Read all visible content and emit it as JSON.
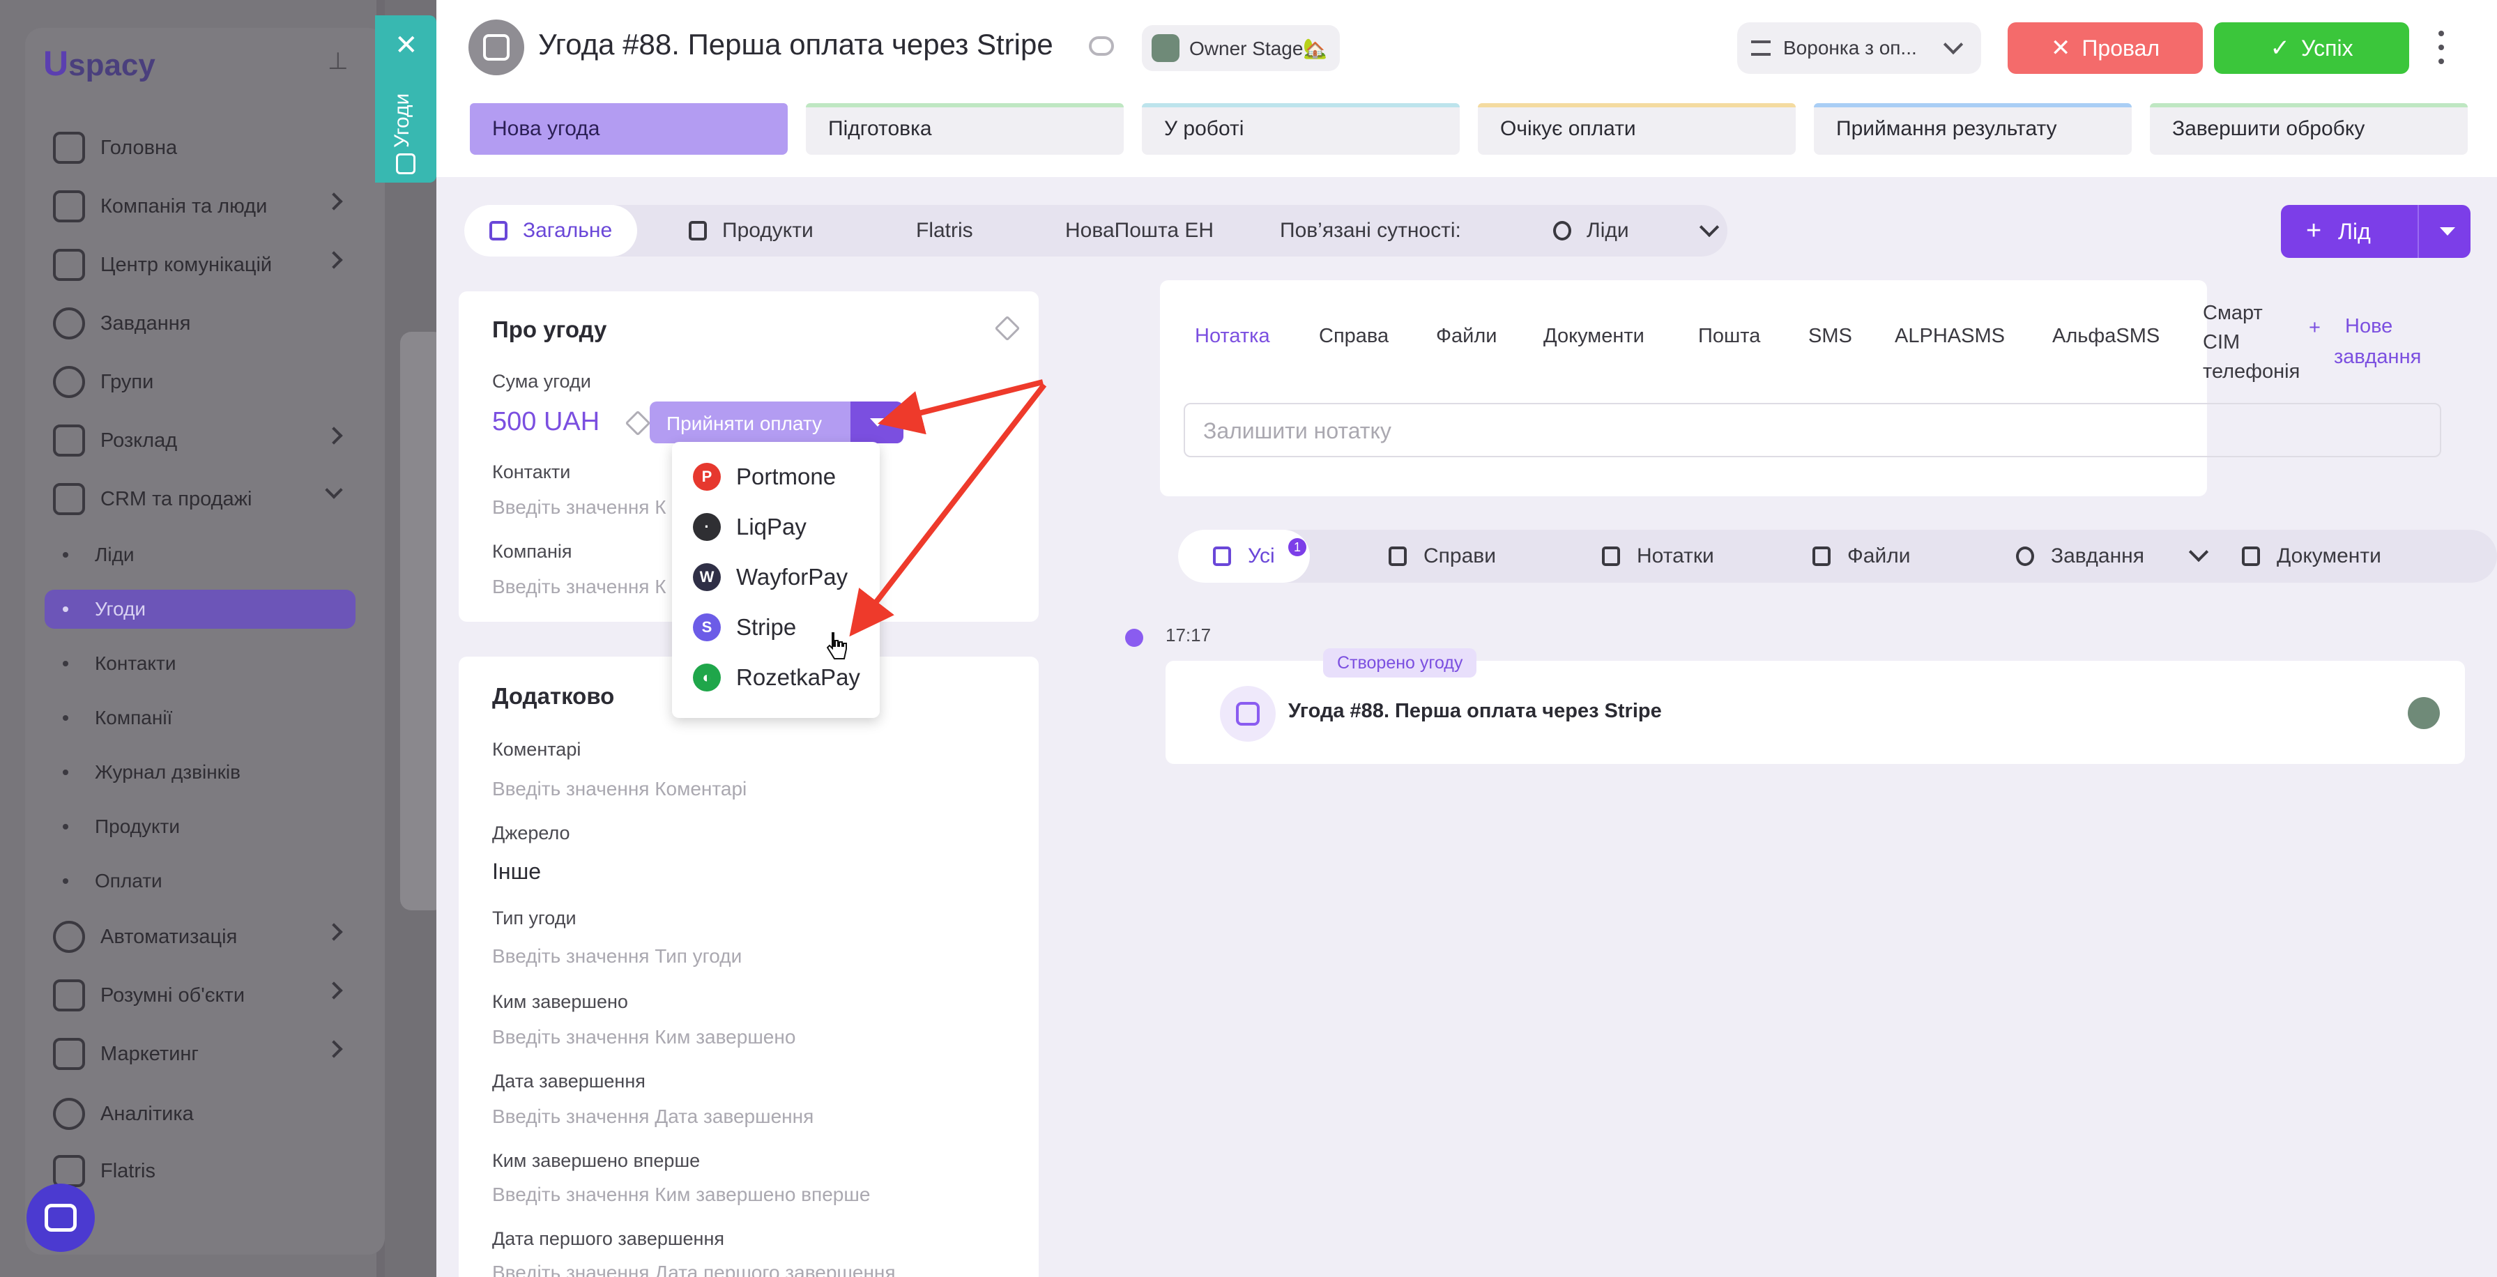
{
  "sidebar": {
    "logo": "spacy",
    "logo_u": "U",
    "items": [
      {
        "label": "Головна"
      },
      {
        "label": "Компанія та люди"
      },
      {
        "label": "Центр комунікацій"
      },
      {
        "label": "Завдання"
      },
      {
        "label": "Групи"
      },
      {
        "label": "Розклад"
      },
      {
        "label": "CRM та продажі"
      }
    ],
    "crm_sub": [
      {
        "label": "Ліди"
      },
      {
        "label": "Угоди"
      },
      {
        "label": "Контакти"
      },
      {
        "label": "Компанії"
      },
      {
        "label": "Журнал дзвінків"
      },
      {
        "label": "Продукти"
      },
      {
        "label": "Оплати"
      }
    ],
    "bottom_items": [
      {
        "label": "Автоматизація"
      },
      {
        "label": "Розумні об'єкти"
      },
      {
        "label": "Маркетинг"
      },
      {
        "label": "Аналітика"
      },
      {
        "label": "Flatris"
      }
    ]
  },
  "side_tab": {
    "label": "Угоди"
  },
  "header": {
    "title": "Угода #88. Перша оплата через Stripe",
    "owner_stage": "Owner Stage🏡",
    "funnel": "Воронка з оп...",
    "fail_label": "Провал",
    "success_label": "Успіх"
  },
  "stages": [
    {
      "label": "Нова угода"
    },
    {
      "label": "Підготовка"
    },
    {
      "label": "У роботі"
    },
    {
      "label": "Очікує оплати"
    },
    {
      "label": "Приймання результату"
    },
    {
      "label": "Завершити обробку"
    }
  ],
  "colors": {
    "stage_bars": [
      "#b39cf2",
      "#bfe7c2",
      "#bde4ec",
      "#f4dba0",
      "#a9cef5",
      "#bfe7c2"
    ],
    "accent": "#7c3ee8",
    "fail": "#f46b6b",
    "success": "#3bc63b"
  },
  "tabs": {
    "general": "Загальне",
    "products": "Продукти",
    "flatris": "Flatris",
    "novaposhta": "НоваПошта ЕН",
    "related": "Пов’язані сутності:",
    "leads": "Ліди"
  },
  "lid_button": "Лід",
  "about": {
    "title": "Про угоду",
    "amount_label": "Сума угоди",
    "amount": "500 UAH",
    "pay_button": "Прийняти оплату",
    "contacts_label": "Контакти",
    "contacts_ph": "Введіть значення К",
    "company_label": "Компанія",
    "company_ph": "Введіть значення К"
  },
  "payment_options": [
    {
      "label": "Portmone",
      "color": "#e6382e",
      "glyph": "P"
    },
    {
      "label": "LiqPay",
      "color": "#2f2f33",
      "glyph": "·"
    },
    {
      "label": "WayforPay",
      "color": "#2f2f46",
      "glyph": "W"
    },
    {
      "label": "Stripe",
      "color": "#6c5ce7",
      "glyph": "S"
    },
    {
      "label": "RozetkaPay",
      "color": "#1fa64a",
      "glyph": "◐"
    }
  ],
  "extra": {
    "title": "Додатково",
    "fields": [
      {
        "label": "Коментарі",
        "value": "Введіть значення Коментарі",
        "placeholder": true
      },
      {
        "label": "Джерело",
        "value": "Інше",
        "placeholder": false
      },
      {
        "label": "Тип угоди",
        "value": "Введіть значення Тип угоди",
        "placeholder": true
      },
      {
        "label": "Ким завершено",
        "value": "Введіть значення Ким завершено",
        "placeholder": true
      },
      {
        "label": "Дата завершення",
        "value": "Введіть значення Дата завершення",
        "placeholder": true
      },
      {
        "label": "Ким завершено вперше",
        "value": "Введіть значення Ким завершено вперше",
        "placeholder": true
      },
      {
        "label": "Дата першого завершення",
        "value": "Введіть значення Дата першого завершення",
        "placeholder": true
      }
    ]
  },
  "activity_tabs": {
    "note": "Нотатка",
    "task_case": "Справа",
    "files": "Файли",
    "documents": "Документи",
    "mail": "Пошта",
    "sms": "SMS",
    "alphasms": "ALPHASMS",
    "alfasms": "АльфаSMS",
    "smart_sim_1": "Смарт",
    "smart_sim_2": "СІМ",
    "smart_sim_3": "телефонія",
    "new_task_1": "Нове",
    "new_task_2": "завдання"
  },
  "note_placeholder": "Залишити нотатку",
  "filters": {
    "all": "Усі",
    "all_count": "1",
    "cases": "Справи",
    "notes": "Нотатки",
    "files": "Файли",
    "tasks": "Завдання",
    "docs": "Документи"
  },
  "timeline": {
    "time": "17:17",
    "badge": "Створено угоду",
    "event_title": "Угода #88. Перша оплата через Stripe"
  }
}
